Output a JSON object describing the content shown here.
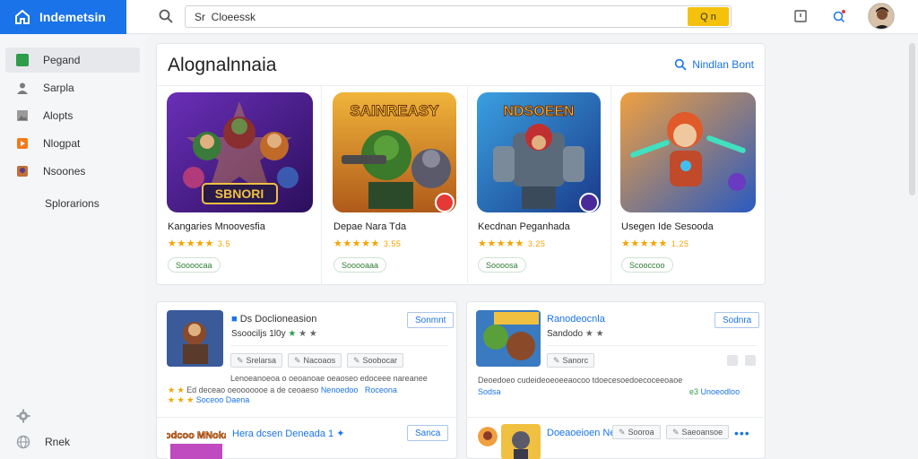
{
  "app": {
    "brand": "Indemetsin"
  },
  "search": {
    "value": "Sr  Cloeessk",
    "button_label": "Q n"
  },
  "sidebar": {
    "items": [
      {
        "label": "Pegand",
        "icon": "green-app-icon",
        "color": "#2e9d4a",
        "active": true
      },
      {
        "label": "Sarpla",
        "icon": "person-icon",
        "color": "#7a7a7a",
        "active": false
      },
      {
        "label": "Alopts",
        "icon": "image-icon",
        "color": "#8a8a8a",
        "active": false
      },
      {
        "label": "Nlogpat",
        "icon": "orange-app-icon",
        "color": "#f07a1a",
        "active": false
      },
      {
        "label": "Nsoones",
        "icon": "game-thumb-icon",
        "color": "#c2703a",
        "active": false
      },
      {
        "label": "Splorarions",
        "icon": "",
        "color": "",
        "active": false
      }
    ],
    "bottom": [
      {
        "label": "",
        "icon": "gear-icon"
      },
      {
        "label": "Rnek",
        "icon": "globe-icon"
      }
    ]
  },
  "featured": {
    "title": "Alognalnnaia",
    "link_label": "Nindlan Bont",
    "cards": [
      {
        "title": "Kangaries Mnoovesfia",
        "art_text": "SBNORI",
        "rating": "3.5",
        "pill": "Soooocaa",
        "badge": ""
      },
      {
        "title": "Depae Nara Tda",
        "art_text": "SAINREASY",
        "rating": "3.55",
        "pill": "Sooooaaa",
        "badge": "red"
      },
      {
        "title": "Kecdnan Peganhada",
        "art_text": "NDSOEEN",
        "rating": "3.25",
        "pill": "Soooosa",
        "badge": "purple"
      },
      {
        "title": "Usegen Ide Sesooda",
        "art_text": "",
        "rating": "1.25",
        "pill": "Scooccoo",
        "badge": ""
      }
    ]
  },
  "list_left": {
    "rows": [
      {
        "title": "Ds Doclioneasion",
        "subtitle": "Ssoociljs 1l0y",
        "button": "Sonmnt",
        "tags": [
          "Srelarsa",
          "Nacoaos",
          "Soobocar"
        ],
        "desc_line1": "Lenoeanoeoa o oeoanoae oeaoseo edoceee nareanee",
        "desc_line2": "Ed deceao oeooooooe a de ceoaeso",
        "desc_link": "Nenoedoo",
        "desc_link2": "Roceona",
        "rating_line": "Soceoo Daena"
      },
      {
        "title": "Hera dcsen Deneada 1",
        "button": "Sanca",
        "art_text": "Bodcoo MNokae"
      }
    ]
  },
  "list_right": {
    "rows": [
      {
        "title": "Ranodeocnla",
        "subtitle": "Sandodo",
        "button": "Sodnra",
        "tags": [
          "Sanorc"
        ],
        "desc_line1": "Deoedoeo cudeideoeoeeaocoo tdoecesoedoecoceeoaoe",
        "desc_line2": "Sodsa",
        "desc_link": "Unoeodloo",
        "desc_link_prefix": "e3"
      },
      {
        "title": "Doeaoeioen Ne",
        "tag": "Sooroa",
        "tag2": "Saeoansoe"
      }
    ]
  },
  "colors": {
    "accent": "#1a73e8",
    "brand": "#1a73e8",
    "star": "#f4a400",
    "search_button": "#f4c20d"
  }
}
